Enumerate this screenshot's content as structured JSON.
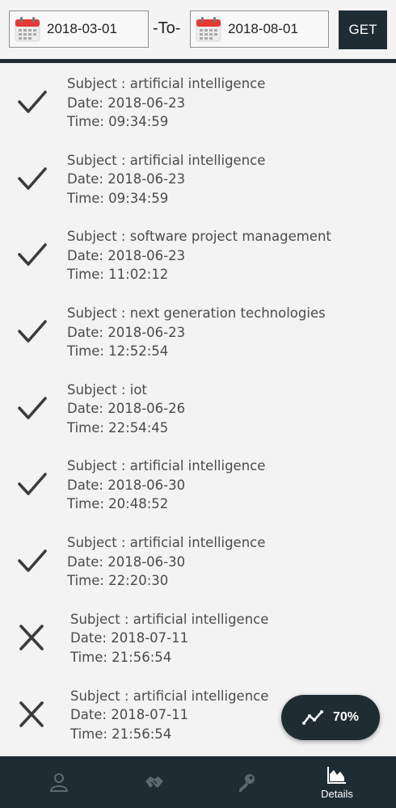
{
  "filter": {
    "from_date": "2018-03-01",
    "separator": "-To-",
    "to_date": "2018-08-01",
    "get_label": "GET"
  },
  "records": [
    {
      "status": "present",
      "subject": "Subject : artificial intelligence",
      "date": "Date: 2018-06-23",
      "time": "Time: 09:34:59"
    },
    {
      "status": "present",
      "subject": "Subject : artificial intelligence",
      "date": "Date: 2018-06-23",
      "time": "Time: 09:34:59"
    },
    {
      "status": "present",
      "subject": "Subject : software project management",
      "date": "Date: 2018-06-23",
      "time": "Time: 11:02:12"
    },
    {
      "status": "present",
      "subject": "Subject : next generation technologies",
      "date": "Date: 2018-06-23",
      "time": "Time: 12:52:54"
    },
    {
      "status": "present",
      "subject": "Subject : iot",
      "date": "Date: 2018-06-26",
      "time": "Time: 22:54:45"
    },
    {
      "status": "present",
      "subject": "Subject : artificial intelligence",
      "date": "Date: 2018-06-30",
      "time": "Time: 20:48:52"
    },
    {
      "status": "present",
      "subject": "Subject : artificial intelligence",
      "date": "Date: 2018-06-30",
      "time": "Time: 22:20:30"
    },
    {
      "status": "absent",
      "subject": "Subject : artificial intelligence",
      "date": "Date: 2018-07-11",
      "time": "Time: 21:56:54"
    },
    {
      "status": "absent",
      "subject": "Subject : artificial intelligence",
      "date": "Date: 2018-07-11",
      "time": "Time: 21:56:54"
    }
  ],
  "fab": {
    "percentage": "70%",
    "icon": "trend-line-icon"
  },
  "bottom_nav": {
    "items": [
      {
        "icon": "person-icon",
        "label": ""
      },
      {
        "icon": "handshake-icon",
        "label": ""
      },
      {
        "icon": "key-icon",
        "label": ""
      },
      {
        "icon": "area-chart-icon",
        "label": "Details"
      }
    ]
  },
  "colors": {
    "dark": "#1e2c33",
    "background": "#f3f3f3",
    "nav_icon_inactive": "#5b6a70"
  }
}
